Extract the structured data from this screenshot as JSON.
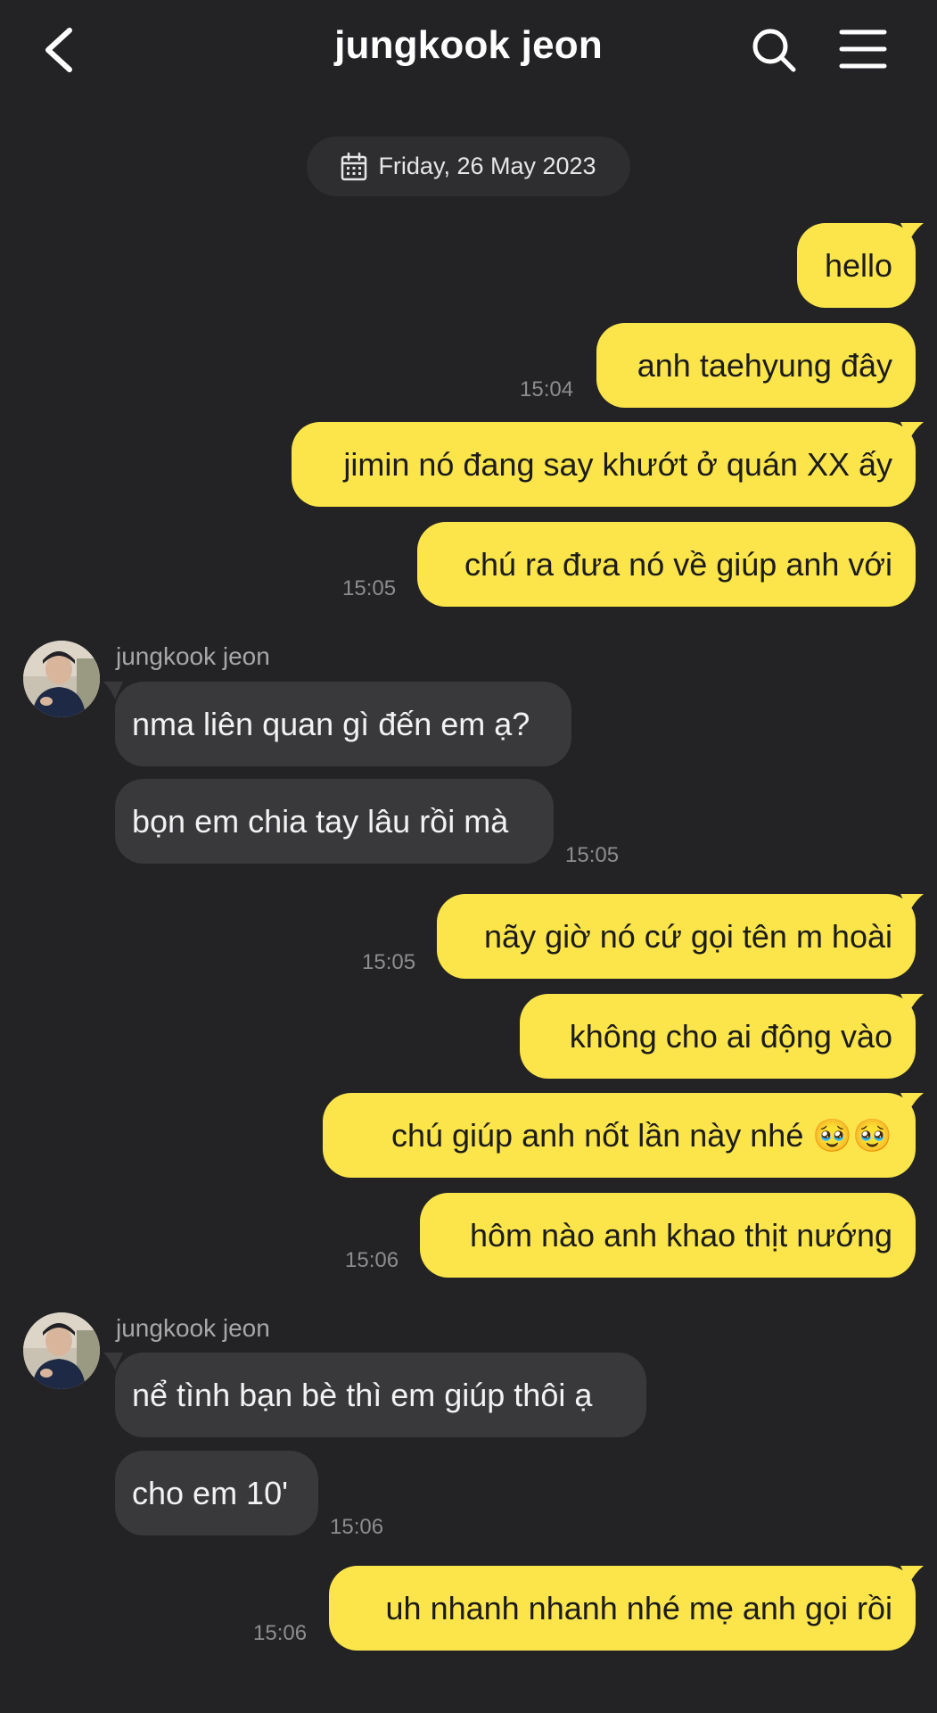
{
  "header": {
    "title": "jungkook jeon",
    "back_icon": "chevron-left-icon",
    "search_icon": "search-icon",
    "menu_icon": "hamburger-menu-icon"
  },
  "date_divider": {
    "icon": "calendar-icon",
    "label": "Friday, 26 May 2023"
  },
  "colors": {
    "background": "#232325",
    "outgoing_bubble": "#fbe54a",
    "incoming_bubble": "#39393c",
    "timestamp": "#8d8d90"
  },
  "messages": [
    {
      "direction": "out",
      "text": "hello"
    },
    {
      "direction": "out",
      "text": "anh taehyung đây",
      "time": "15:04"
    },
    {
      "direction": "out",
      "text": "jimin nó đang say khướt ở quán XX ấy"
    },
    {
      "direction": "out",
      "text": "chú ra đưa nó về giúp anh với",
      "time": "15:05"
    },
    {
      "direction": "in",
      "sender": "jungkook jeon",
      "text": "nma liên quan gì đến em ạ?"
    },
    {
      "direction": "in",
      "text": "bọn em chia tay lâu rồi mà",
      "time": "15:05"
    },
    {
      "direction": "out",
      "text": "nãy giờ nó cứ gọi tên m hoài",
      "time": "15:05"
    },
    {
      "direction": "out",
      "text": "không cho ai động vào"
    },
    {
      "direction": "out",
      "text": "chú giúp anh nốt lần này nhé 🥹🥹"
    },
    {
      "direction": "out",
      "text": "hôm nào anh khao thịt nướng",
      "time": "15:06"
    },
    {
      "direction": "in",
      "sender": "jungkook jeon",
      "text": "nể tình bạn bè thì em giúp thôi ạ"
    },
    {
      "direction": "in",
      "text": "cho em 10'",
      "time": "15:06"
    },
    {
      "direction": "out",
      "text": "uh nhanh nhanh nhé mẹ anh gọi rồi",
      "time": "15:06"
    }
  ]
}
